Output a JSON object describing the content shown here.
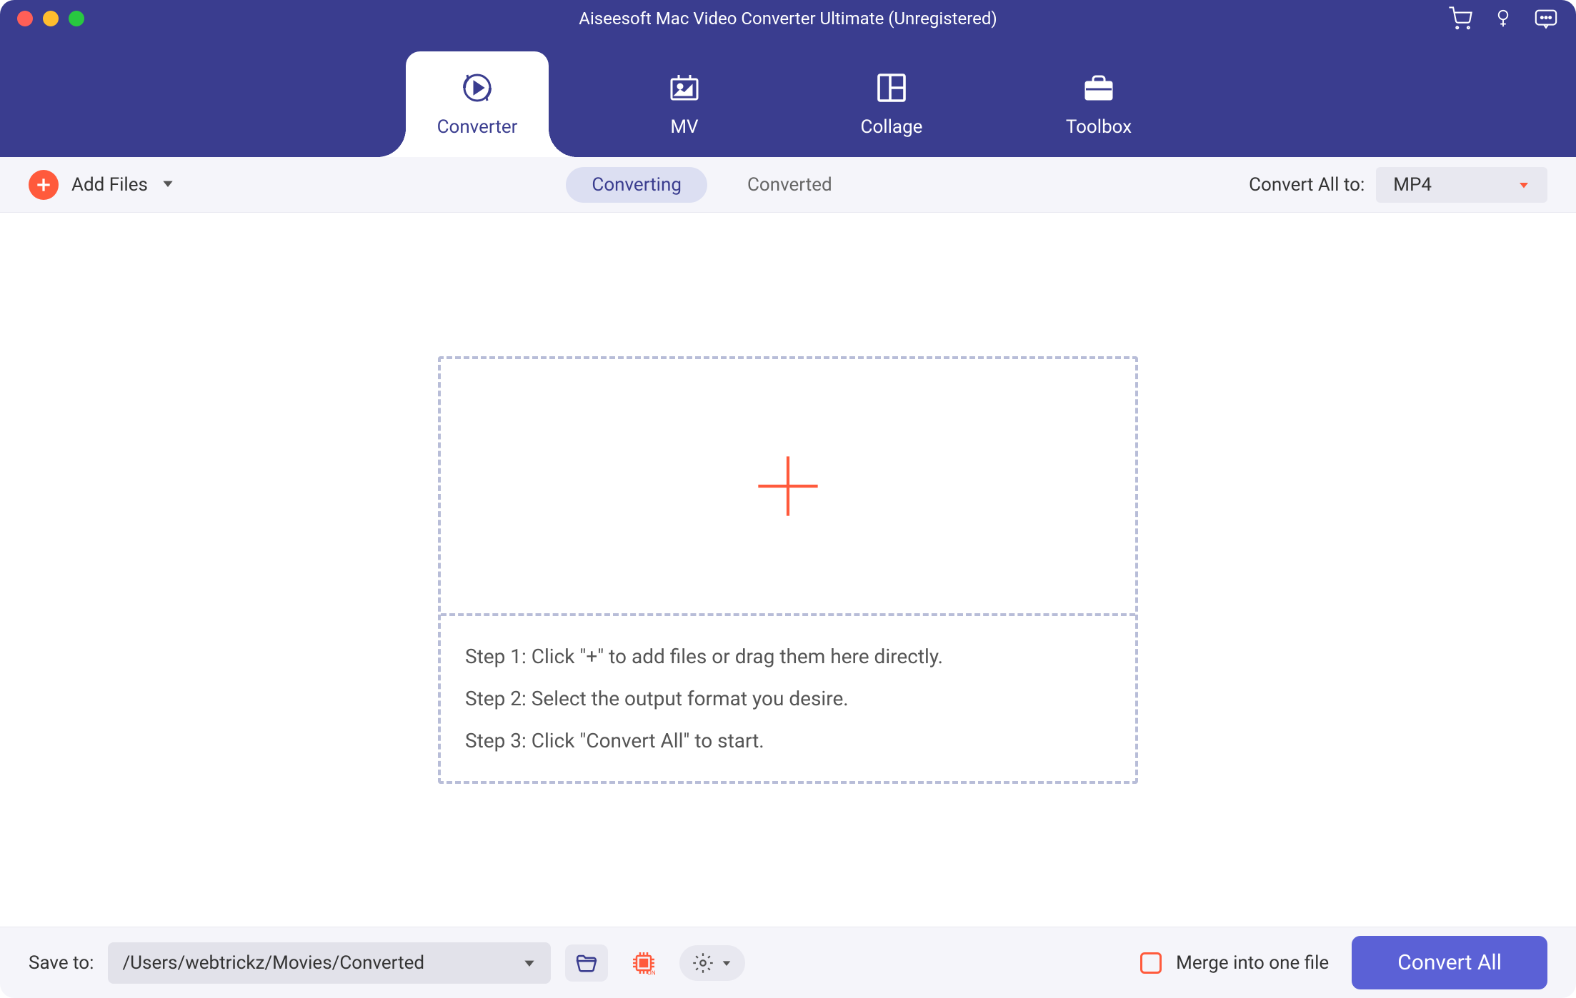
{
  "title": "Aiseesoft Mac Video Converter Ultimate (Unregistered)",
  "tabs": [
    {
      "label": "Converter",
      "active": true
    },
    {
      "label": "MV",
      "active": false
    },
    {
      "label": "Collage",
      "active": false
    },
    {
      "label": "Toolbox",
      "active": false
    }
  ],
  "toolbar": {
    "add_files_label": "Add Files",
    "segments": {
      "converting": "Converting",
      "converted": "Converted"
    },
    "convert_all_to_label": "Convert All to:",
    "format_value": "MP4"
  },
  "dropzone": {
    "steps": [
      "Step 1: Click \"+\" to add files or drag them here directly.",
      "Step 2: Select the output format you desire.",
      "Step 3: Click \"Convert All\" to start."
    ]
  },
  "bottombar": {
    "save_to_label": "Save to:",
    "path": "/Users/webtrickz/Movies/Converted",
    "merge_label": "Merge into one file",
    "convert_btn_label": "Convert All"
  }
}
